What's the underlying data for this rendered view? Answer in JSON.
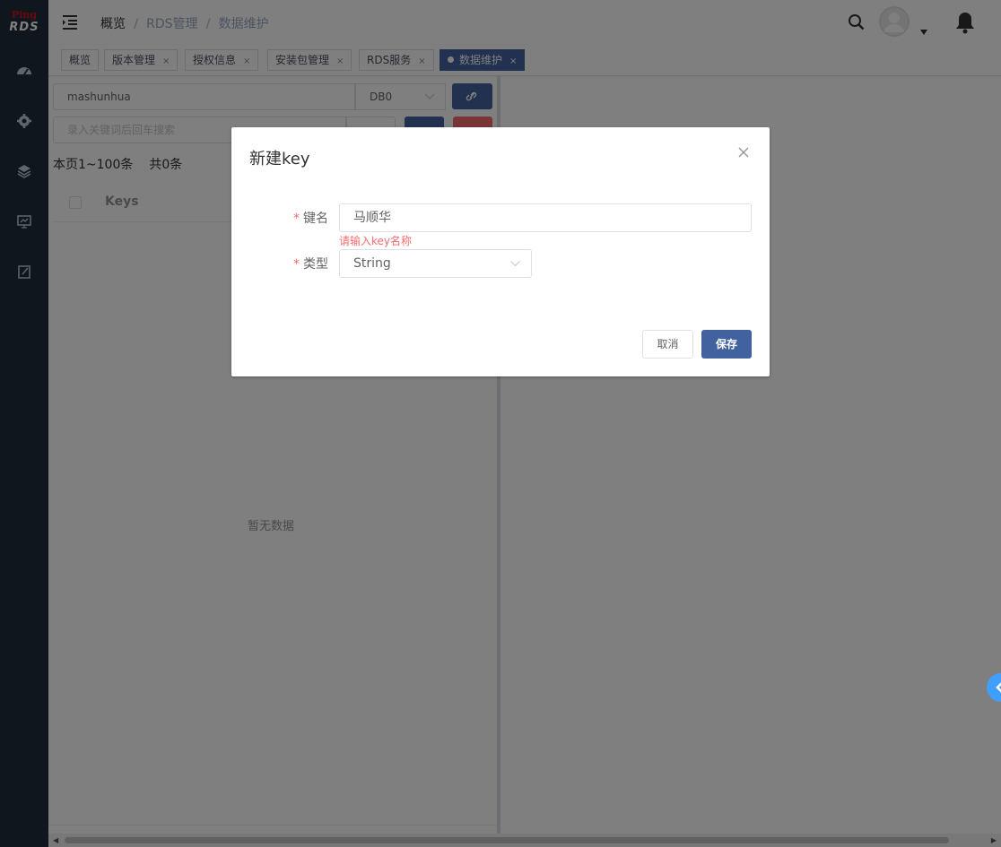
{
  "logo": {
    "top": "Ping",
    "bottom": "RDS"
  },
  "breadcrumb": [
    "概览",
    "RDS管理",
    "数据维护"
  ],
  "tags": [
    {
      "label": "概览",
      "closable": false
    },
    {
      "label": "版本管理",
      "closable": true
    },
    {
      "label": "授权信息",
      "closable": true
    },
    {
      "label": "安装包管理",
      "closable": true
    },
    {
      "label": "RDS服务",
      "closable": true
    },
    {
      "label": "数据维护",
      "closable": true,
      "active": true
    }
  ],
  "tag_close": "×",
  "toolbar": {
    "host_value": "mashunhua",
    "db_value": "DB0",
    "search_placeholder": "录入关键词后回车搜索"
  },
  "page_info": {
    "range": "本页1~100条",
    "total": "共0条"
  },
  "table": {
    "column": "Keys",
    "empty_text": "暂无数据"
  },
  "dialog": {
    "title": "新建key",
    "name_label": "键名",
    "name_value": "马顺华",
    "name_error": "请输入key名称",
    "type_label": "类型",
    "type_value": "String",
    "required_mark": "*",
    "cancel_label": "取消",
    "save_label": "保存"
  },
  "colors": {
    "primary": "#42629f",
    "danger": "#f56c6c",
    "sidebar": "#1f2d3d",
    "float": "#409eff"
  }
}
